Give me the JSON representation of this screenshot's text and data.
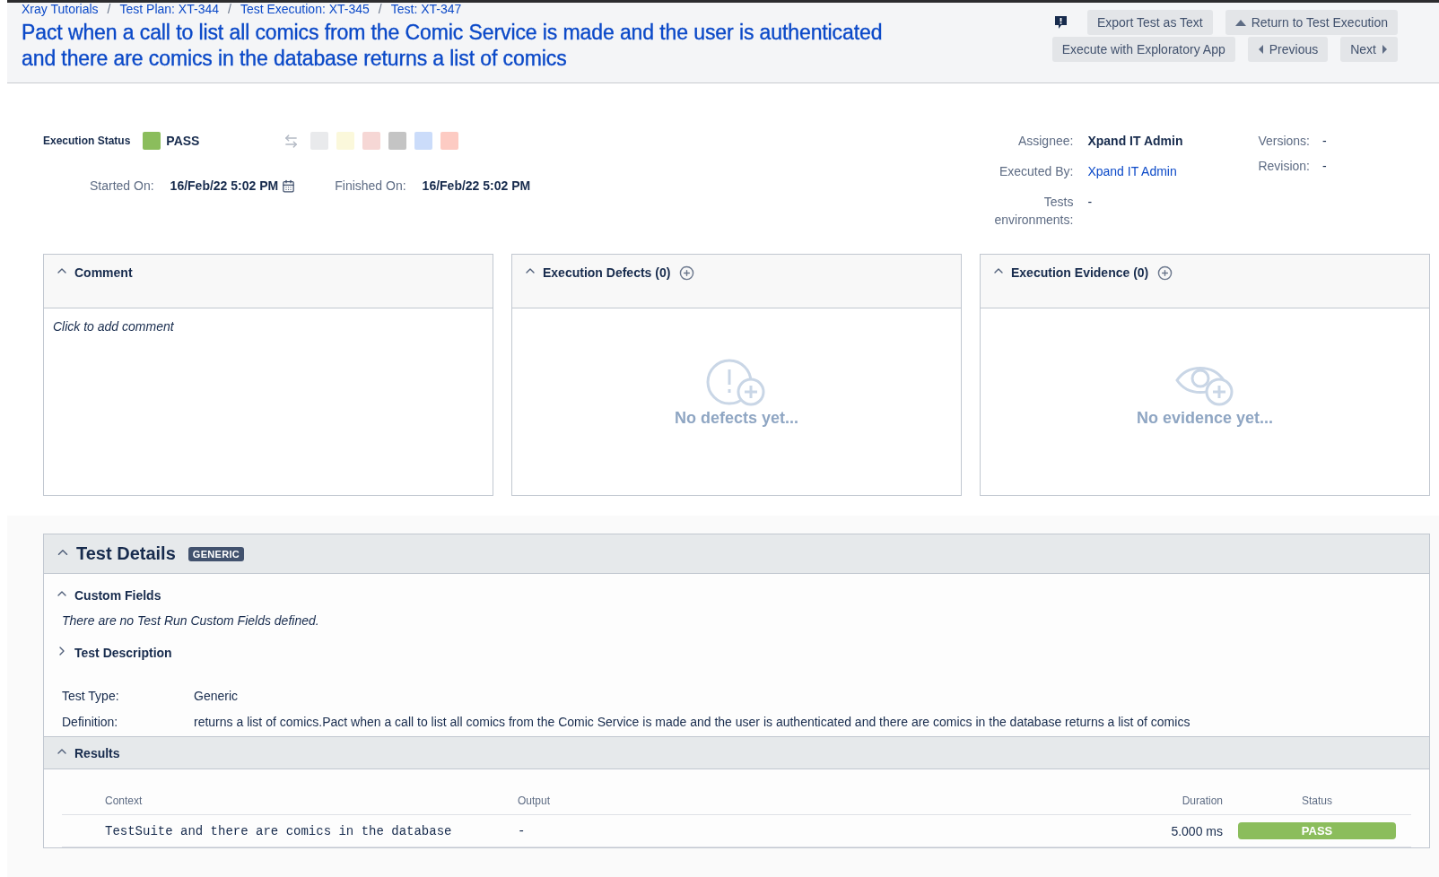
{
  "breadcrumbs": {
    "separator": "/",
    "items": [
      "Xray Tutorials",
      "Test Plan: XT-344",
      "Test Execution: XT-345",
      "Test: XT-347"
    ]
  },
  "title": "Pact when a call to list all comics from the Comic Service is made and the user is authenticated and there are comics in the database returns a list of comics",
  "button_rows": [
    [
      {
        "label": "Export Test as Text",
        "kind": "plain"
      },
      {
        "label": "Return to Test Execution",
        "kind": "up"
      }
    ],
    [
      {
        "label": "Execute with Exploratory App",
        "kind": "plain"
      },
      {
        "label": "Previous",
        "kind": "prev"
      },
      {
        "label": "Next",
        "kind": "next"
      }
    ]
  ],
  "execution_status": {
    "label": "Execution Status",
    "value": "PASS",
    "color": "#8bbd5c"
  },
  "status_swatches": [
    {
      "color": "#e9eaec"
    },
    {
      "color": "#fbf8db"
    },
    {
      "color": "#f6d7d5"
    },
    {
      "color": "#c4c4c4"
    },
    {
      "color": "#cbdcfa"
    },
    {
      "color": "#fdcbc3"
    }
  ],
  "started": {
    "label": "Started On:",
    "value": "16/Feb/22 5:02 PM"
  },
  "finished": {
    "label": "Finished On:",
    "value": "16/Feb/22 5:02 PM"
  },
  "people": [
    {
      "label": "Assignee:",
      "value": "Xpand IT Admin",
      "kind": "bold"
    },
    {
      "label": "Executed By:",
      "value": "Xpand IT Admin",
      "kind": "link"
    },
    {
      "label": "Tests environments:",
      "value": "-",
      "kind": "plain"
    }
  ],
  "versions": [
    {
      "label": "Versions:",
      "value": "-"
    },
    {
      "label": "Revision:",
      "value": "-"
    }
  ],
  "panels": [
    {
      "title": "Comment",
      "kind": "comment",
      "expanded": true,
      "hint": "Click to add comment"
    },
    {
      "title": "Execution Defects (0)",
      "kind": "defects",
      "expanded": true,
      "empty": "No defects yet..."
    },
    {
      "title": "Execution Evidence (0)",
      "kind": "evidence",
      "expanded": true,
      "empty": "No evidence yet..."
    }
  ],
  "test_details": {
    "title": "Test Details",
    "badge": "GENERIC",
    "expanded": true,
    "custom_fields": {
      "title": "Custom Fields",
      "expanded": true,
      "message": "There are no Test Run Custom Fields defined."
    },
    "test_description": {
      "title": "Test Description",
      "expanded": false
    },
    "fields": [
      {
        "label": "Test Type:",
        "value": "Generic"
      },
      {
        "label": "Definition:",
        "value": "returns a list of comics.Pact when a call to list all comics from the Comic Service is made and the user is authenticated and there are comics in the database returns a list of comics"
      }
    ],
    "results": {
      "title": "Results",
      "expanded": true,
      "columns": [
        "Context",
        "Output",
        "Duration",
        "Status"
      ],
      "rows": [
        {
          "context": "TestSuite and there are comics in the database",
          "output": "-",
          "duration": "5.000 ms",
          "status": "PASS",
          "color": "#8bbd5c"
        }
      ]
    }
  }
}
